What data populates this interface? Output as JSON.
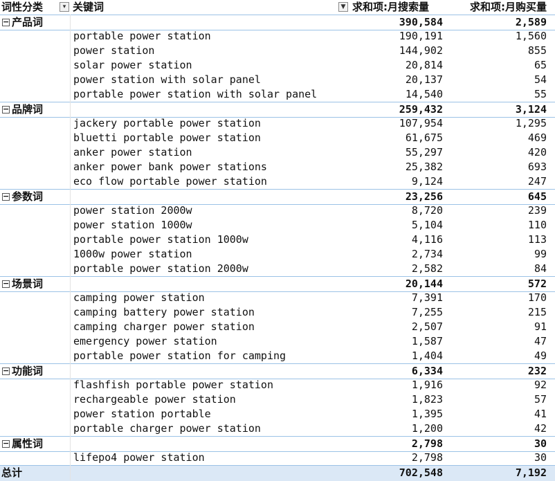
{
  "header": {
    "col_category": "词性分类",
    "col_keyword": "关键词",
    "col_search": "求和项:月搜索量",
    "col_buy": "求和项:月购买量",
    "keyword_dropdown_icon": "dropdown-arrow-icon",
    "filter_icon": "filter-icon"
  },
  "groups": [
    {
      "name": "产品词",
      "search": "390,584",
      "buy": "2,589",
      "rows": [
        {
          "kw": "portable power station",
          "search": "190,191",
          "buy": "1,560"
        },
        {
          "kw": "power station",
          "search": "144,902",
          "buy": "855"
        },
        {
          "kw": "solar power station",
          "search": "20,814",
          "buy": "65"
        },
        {
          "kw": "power station with solar panel",
          "search": "20,137",
          "buy": "54"
        },
        {
          "kw": "portable power station with solar panel",
          "search": "14,540",
          "buy": "55"
        }
      ]
    },
    {
      "name": "品牌词",
      "search": "259,432",
      "buy": "3,124",
      "rows": [
        {
          "kw": "jackery portable power station",
          "search": "107,954",
          "buy": "1,295"
        },
        {
          "kw": "bluetti portable power station",
          "search": "61,675",
          "buy": "469"
        },
        {
          "kw": "anker power station",
          "search": "55,297",
          "buy": "420"
        },
        {
          "kw": "anker power bank power stations",
          "search": "25,382",
          "buy": "693"
        },
        {
          "kw": "eco flow portable power station",
          "search": "9,124",
          "buy": "247"
        }
      ]
    },
    {
      "name": "参数词",
      "search": "23,256",
      "buy": "645",
      "rows": [
        {
          "kw": "power station 2000w",
          "search": "8,720",
          "buy": "239"
        },
        {
          "kw": "power station 1000w",
          "search": "5,104",
          "buy": "110"
        },
        {
          "kw": "portable power station 1000w",
          "search": "4,116",
          "buy": "113"
        },
        {
          "kw": "1000w power station",
          "search": "2,734",
          "buy": "99"
        },
        {
          "kw": "portable power station 2000w",
          "search": "2,582",
          "buy": "84"
        }
      ]
    },
    {
      "name": "场景词",
      "search": "20,144",
      "buy": "572",
      "rows": [
        {
          "kw": "camping power station",
          "search": "7,391",
          "buy": "170"
        },
        {
          "kw": "camping battery power station",
          "search": "7,255",
          "buy": "215"
        },
        {
          "kw": "camping charger power station",
          "search": "2,507",
          "buy": "91"
        },
        {
          "kw": "emergency power station",
          "search": "1,587",
          "buy": "47"
        },
        {
          "kw": "portable power station for camping",
          "search": "1,404",
          "buy": "49"
        }
      ]
    },
    {
      "name": "功能词",
      "search": "6,334",
      "buy": "232",
      "rows": [
        {
          "kw": "flashfish portable power station",
          "search": "1,916",
          "buy": "92"
        },
        {
          "kw": "rechargeable power station",
          "search": "1,823",
          "buy": "57"
        },
        {
          "kw": "power station portable",
          "search": "1,395",
          "buy": "41"
        },
        {
          "kw": "portable charger power station",
          "search": "1,200",
          "buy": "42"
        }
      ]
    },
    {
      "name": "属性词",
      "search": "2,798",
      "buy": "30",
      "rows": [
        {
          "kw": "lifepo4 power station",
          "search": "2,798",
          "buy": "30"
        }
      ]
    }
  ],
  "total": {
    "label": "总计",
    "search": "702,548",
    "buy": "7,192"
  },
  "collapse_icon": "collapse-minus-icon"
}
